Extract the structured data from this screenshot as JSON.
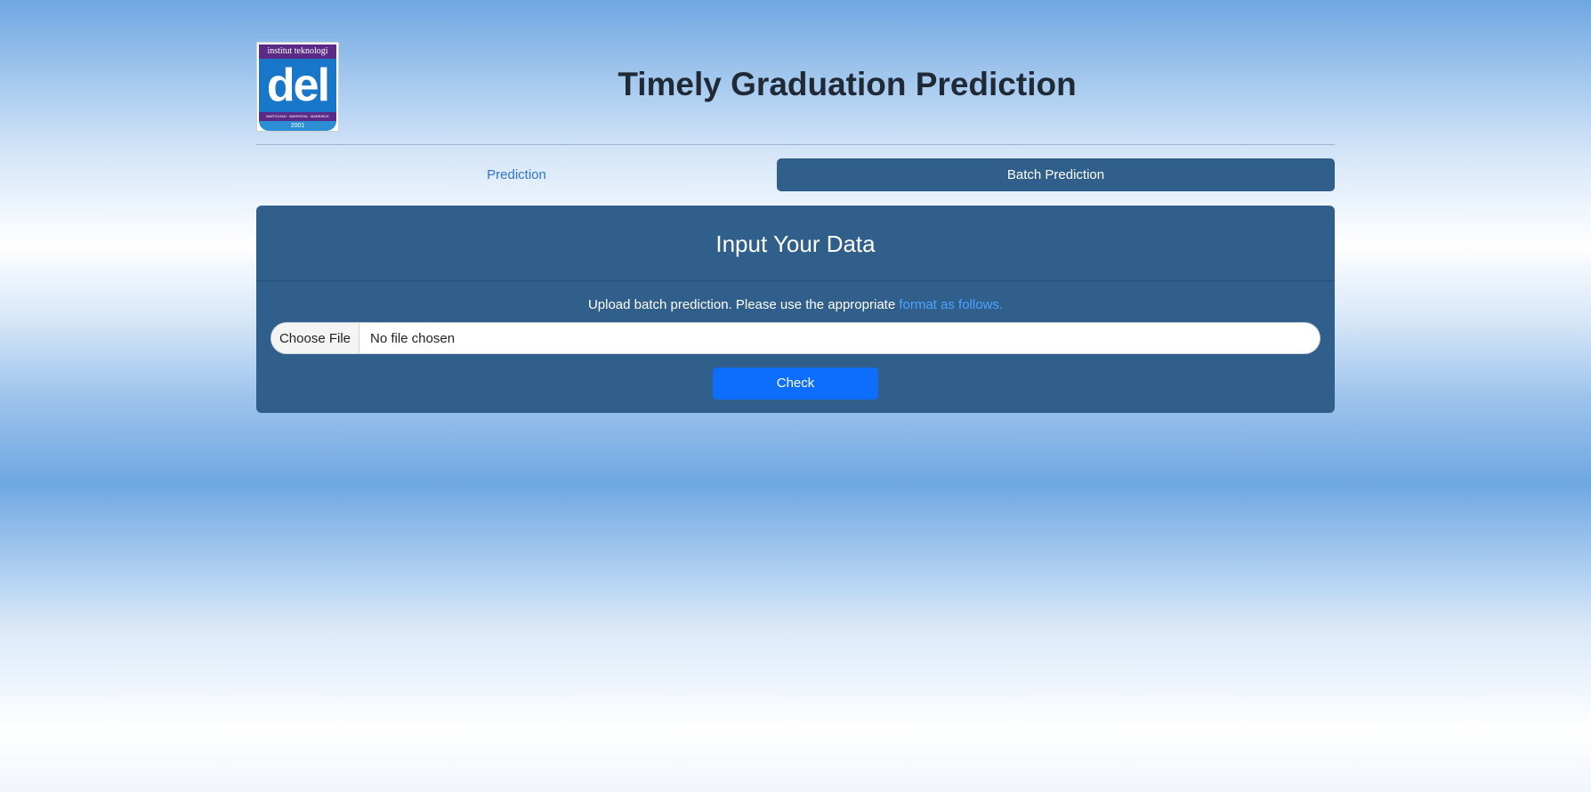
{
  "header": {
    "title": "Timely Graduation Prediction",
    "logo": {
      "top_text": "institut teknologi",
      "main_text": "del",
      "band_text": "MARTUHAN · MARROHA · MARBISUK",
      "year": "2001"
    }
  },
  "tabs": [
    {
      "label": "Prediction",
      "active": false
    },
    {
      "label": "Batch Prediction",
      "active": true
    }
  ],
  "card": {
    "title": "Input Your Data",
    "upload_text": "Upload batch prediction. Please use the appropriate ",
    "format_link": "format as follows.",
    "file_button": "Choose File",
    "file_status": "No file chosen",
    "check_button": "Check"
  },
  "colors": {
    "card_bg": "#2f5f8a",
    "primary_button": "#0d6efd",
    "link": "#4da3ff",
    "tab_inactive_text": "#2f75c9"
  }
}
